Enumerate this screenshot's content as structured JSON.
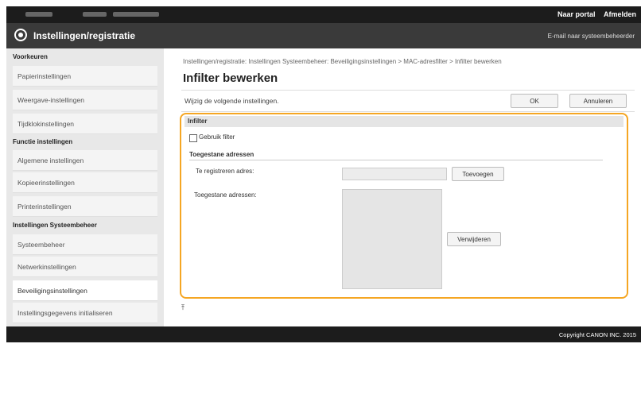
{
  "header": {
    "portal_link": "Naar portal",
    "logout_link": "Afmelden",
    "app_title": "Instellingen/registratie",
    "email_link": "E-mail naar systeembeheerder"
  },
  "sidebar": {
    "section1": "Voorkeuren",
    "section1_items": [
      "Papierinstellingen",
      "Weergave-instellingen",
      "Tijdklokinstellingen"
    ],
    "section2": "Functie instellingen",
    "section2_items": [
      "Algemene instellingen",
      "Kopieerinstellingen",
      "Printerinstellingen"
    ],
    "section3": "Instellingen Systeembeheer",
    "section3_items": [
      "Systeembeheer",
      "Netwerkinstellingen",
      "Beveiligingsinstellingen",
      "Instellingsgegevens initialiseren"
    ],
    "active_item": "Beveiligingsinstellingen"
  },
  "main": {
    "breadcrumb": "Instellingen/registratie: Instellingen Systeembeheer: Beveiligingsinstellingen > MAC-adresfilter > Infilter bewerken",
    "page_title": "Infilter bewerken",
    "instruction": "Wijzig de volgende instellingen.",
    "ok_button": "OK",
    "cancel_button": "Annuleren",
    "filter_section": "Infilter",
    "use_filter_label": "Gebruik filter",
    "use_filter_checked": false,
    "allowed_section": "Toegestane adressen",
    "register_label": "Te registreren adres:",
    "register_value": "",
    "add_button": "Toevoegen",
    "allowed_list_label": "Toegestane adressen:",
    "remove_button": "Verwijderen",
    "top_icon": "⤒"
  },
  "footer": {
    "copyright": "Copyright CANON INC. 2015"
  }
}
